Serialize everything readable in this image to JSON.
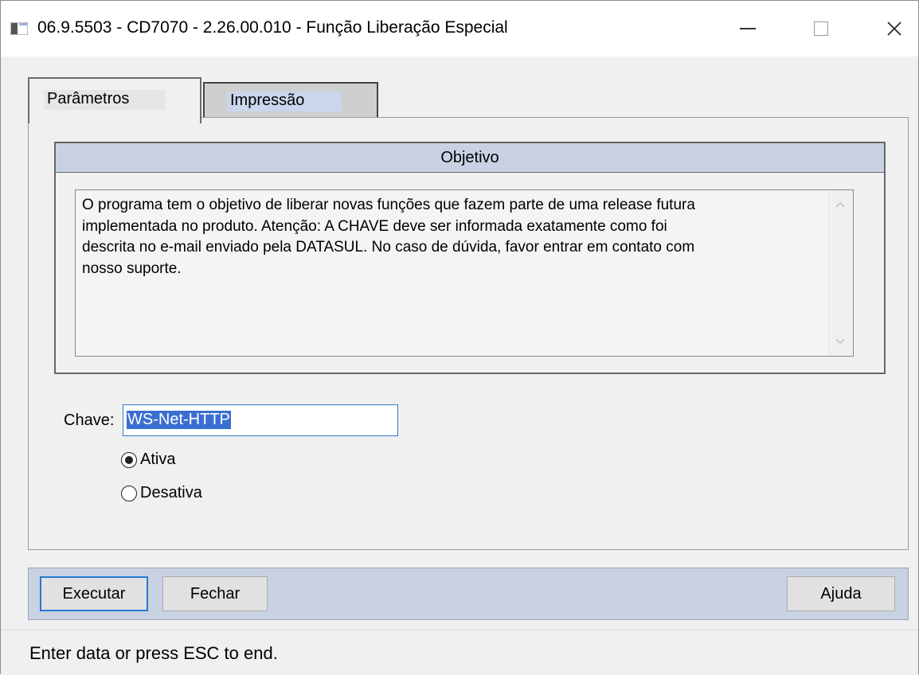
{
  "window": {
    "title": "06.9.5503 - CD7070 - 2.26.00.010 - Função Liberação Especial",
    "minimize_glyph": "—",
    "maximize_glyph": "☐",
    "close_glyph": "✕"
  },
  "tabs": [
    {
      "label": "Parâmetros",
      "active": true
    },
    {
      "label": "Impressão",
      "active": false
    }
  ],
  "objetivo": {
    "header": "Objetivo",
    "lines": [
      "O programa tem o objetivo de liberar novas funções que fazem parte de uma release futura",
      "implementada no produto. Atenção: A CHAVE deve ser informada exatamente como foi",
      "descrita no e-mail enviado pela DATASUL. No caso de dúvida, favor entrar em contato com",
      "nosso suporte."
    ]
  },
  "chave": {
    "label": "Chave:",
    "value": "WS-Net-HTTP"
  },
  "radios": [
    {
      "label": "Ativa",
      "checked": true
    },
    {
      "label": "Desativa",
      "checked": false
    }
  ],
  "buttons": {
    "executar": "Executar",
    "fechar": "Fechar",
    "ajuda": "Ajuda"
  },
  "status": "Enter data or press ESC to end.",
  "colors": {
    "header_bg": "#c8d2e3",
    "selection": "#3a6fd1",
    "focus_border": "#2878d4"
  }
}
